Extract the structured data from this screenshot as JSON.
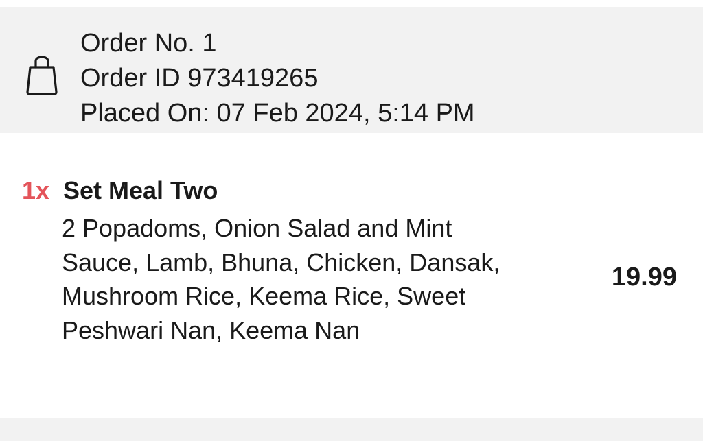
{
  "order_header": {
    "icon": "shopping-bag-icon",
    "order_number": "Order No. 1",
    "order_id": "Order ID 973419265",
    "placed_on": "Placed On: 07 Feb 2024, 5:14 PM"
  },
  "items": [
    {
      "quantity": "1x",
      "name": "Set Meal Two",
      "description": "2 Popadoms, Onion Salad and Mint Sauce, Lamb, Bhuna, Chicken, Dansak, Mushroom Rice, Keema Rice, Sweet Peshwari Nan, Keema Nan",
      "price": "19.99"
    }
  ],
  "colors": {
    "header_background": "#f2f2f2",
    "quantity_accent": "#e4545a",
    "text": "#1a1a1a"
  }
}
